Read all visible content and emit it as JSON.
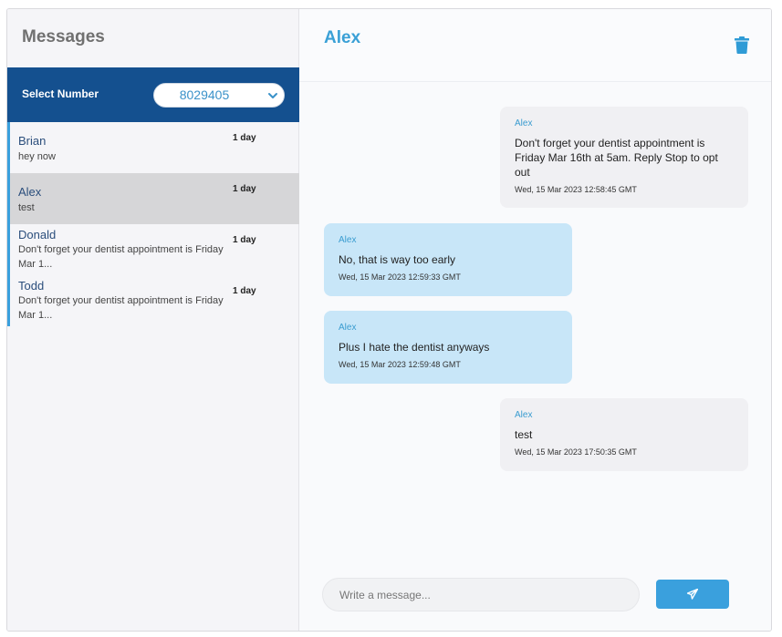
{
  "sidebar": {
    "title": "Messages",
    "select_label": "Select Number",
    "selected_number": "8029405",
    "threads": [
      {
        "name": "Brian",
        "preview": "hey now",
        "time": "1 day"
      },
      {
        "name": "Alex",
        "preview": "test",
        "time": "1 day"
      },
      {
        "name": "Donald",
        "preview": "Don't forget your dentist appointment is Friday Mar 1...",
        "time": "1 day"
      },
      {
        "name": "Todd",
        "preview": "Don't forget your dentist appointment is Friday Mar 1...",
        "time": "1 day"
      }
    ]
  },
  "conversation": {
    "title": "Alex",
    "messages": [
      {
        "direction": "outgoing",
        "author": "Alex",
        "text": "Don't forget your dentist appointment is Friday Mar 16th at 5am. Reply Stop to opt out",
        "time": "Wed, 15 Mar 2023 12:58:45 GMT"
      },
      {
        "direction": "incoming",
        "author": "Alex",
        "text": "No, that is way too early",
        "time": "Wed, 15 Mar 2023 12:59:33 GMT"
      },
      {
        "direction": "incoming",
        "author": "Alex",
        "text": "Plus I hate the dentist anyways",
        "time": "Wed, 15 Mar 2023 12:59:48 GMT"
      },
      {
        "direction": "outgoing",
        "author": "Alex",
        "text": "test",
        "time": "Wed, 15 Mar 2023 17:50:35 GMT"
      }
    ]
  },
  "composer": {
    "placeholder": "Write a message...",
    "value": ""
  },
  "icons": {
    "trash": "trash-icon",
    "send": "paper-plane-icon",
    "chevron": "chevron-down-icon"
  },
  "colors": {
    "accent": "#3aa0dd",
    "header_bar": "#14508f",
    "incoming_bubble": "#c8e6f8",
    "outgoing_bubble": "#f0f0f3"
  }
}
